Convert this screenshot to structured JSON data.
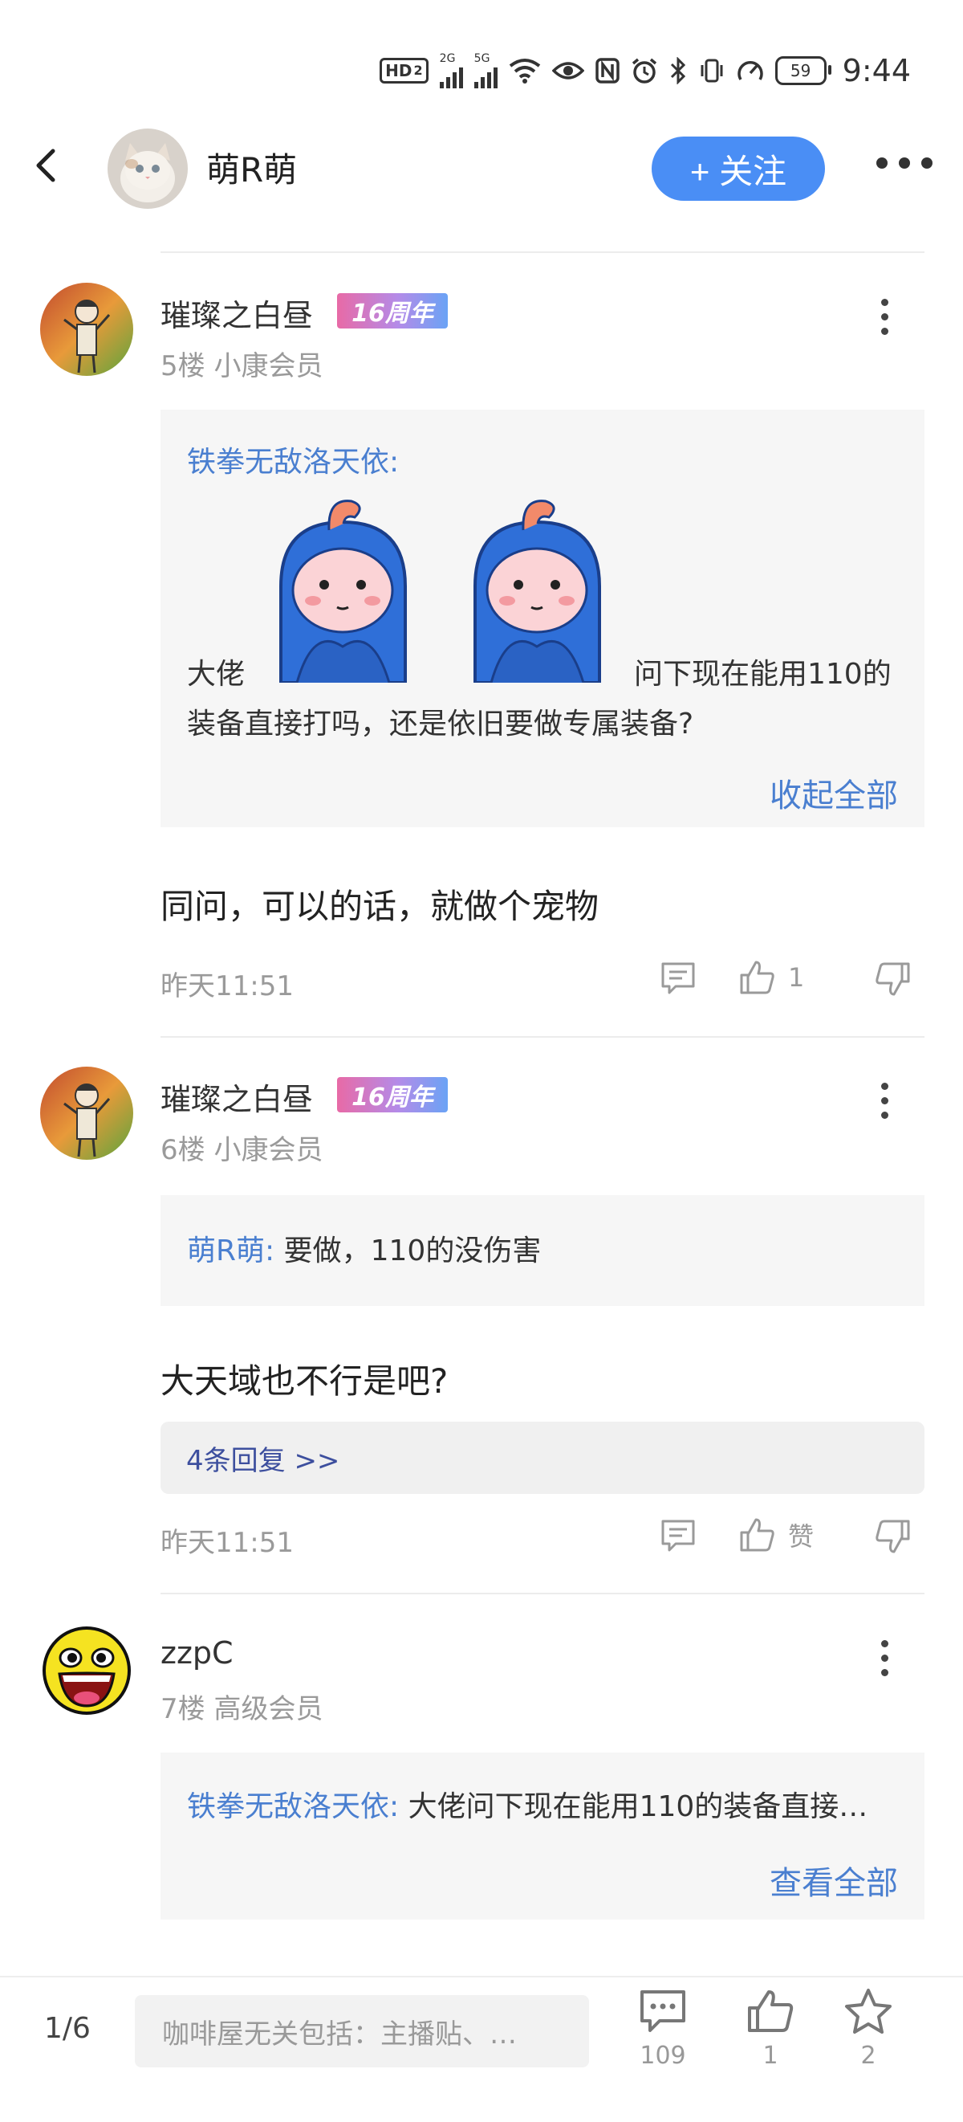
{
  "status_bar": {
    "hd": "HD",
    "sim": "2",
    "net1": "2G",
    "net2": "5G",
    "battery": "59",
    "time": "9:44"
  },
  "header": {
    "back_icon": "chevron-left-icon",
    "title": "萌R萌",
    "follow_label": "+ 关注",
    "more_icon": "more-horizontal-icon"
  },
  "posts": [
    {
      "username": "璀璨之白昼",
      "badge": "16周年",
      "meta": "5楼 小康会员",
      "quote": {
        "user": "铁拳无敌洛天依:",
        "text_before": "大佬",
        "text_after_line1": "问下现在能用110的",
        "text_line2": "装备直接打吗，还是依旧要做专属装备?",
        "collapse_label": "收起全部"
      },
      "content": "同问，可以的话，就做个宠物",
      "time": "昨天11:51",
      "like_count": "1"
    },
    {
      "username": "璀璨之白昼",
      "badge": "16周年",
      "meta": "6楼 小康会员",
      "quote": {
        "user": "萌R萌:",
        "text": "要做，110的没伤害"
      },
      "content": "大天域也不行是吧?",
      "replies_label": "4条回复 >>",
      "time": "昨天11:51",
      "like_label": "赞"
    },
    {
      "username": "zzpC",
      "meta": "7楼 高级会员",
      "quote": {
        "user": "铁拳无敌洛天依:",
        "text": "大佬问下现在能用110的装备直接…",
        "expand_label": "查看全部"
      }
    }
  ],
  "bottom_bar": {
    "page_indicator": "1/6",
    "search_placeholder": "咖啡屋无关包括：主播贴、…",
    "comment_count": "109",
    "like_count": "1",
    "star_count": "2"
  },
  "colors": {
    "accent": "#4a8ef5",
    "link": "#4a7fd0",
    "quote_bg": "#f6f6f6"
  }
}
